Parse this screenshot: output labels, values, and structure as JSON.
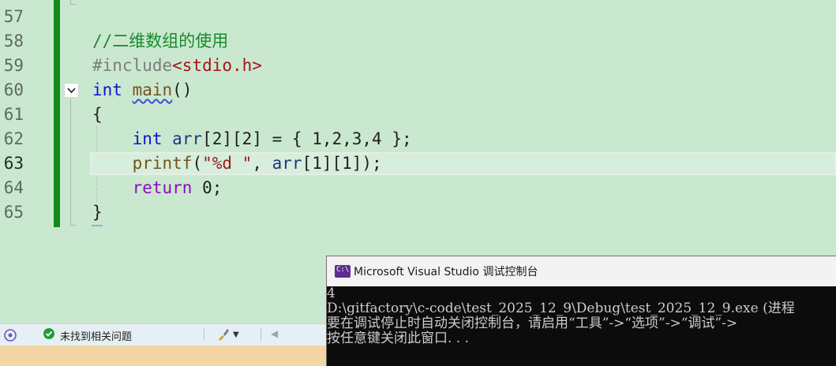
{
  "editor": {
    "line_numbers": [
      "57",
      "58",
      "59",
      "60",
      "61",
      "62",
      "63",
      "64",
      "65"
    ],
    "current_line": "63",
    "code": {
      "comment": "//二维数组的使用",
      "include_directive": "#include",
      "include_header": "<stdio.h>",
      "kw_int": "int",
      "main_name": "main",
      "main_parens": "()",
      "open_brace": "{",
      "arr_decl_kw": "int",
      "arr_decl_rest_name": "arr",
      "arr_decl_dims": "[2][2] = { ",
      "arr_decl_values": "1,2,3,4",
      "arr_decl_end": " };",
      "printf_name": "printf",
      "printf_open": "(",
      "printf_fmt": "\"%d \"",
      "printf_comma": ", ",
      "printf_arr": "arr",
      "printf_idx": "[1][1]);",
      "return_kw": "return",
      "return_val": " 0;",
      "close_brace": "}"
    }
  },
  "statusbar": {
    "issues_text": "未找到相关问题"
  },
  "console": {
    "title": "Microsoft Visual Studio 调试控制台",
    "icon_text": "C:\\",
    "lines": [
      "4",
      "D:\\gitfactory\\c-code\\test_2025_12_9\\Debug\\test_2025_12_9.exe (进程",
      "要在调试停止时自动关闭控制台，请启用“工具”->“选项”->“调试”->",
      "按任意键关闭此窗口. . ."
    ]
  },
  "colors": {
    "editor_bg": "#cae8cf",
    "change_bar": "#138a1a",
    "console_bg": "#0c0c0c",
    "status_accent": "#5b5fd1"
  }
}
